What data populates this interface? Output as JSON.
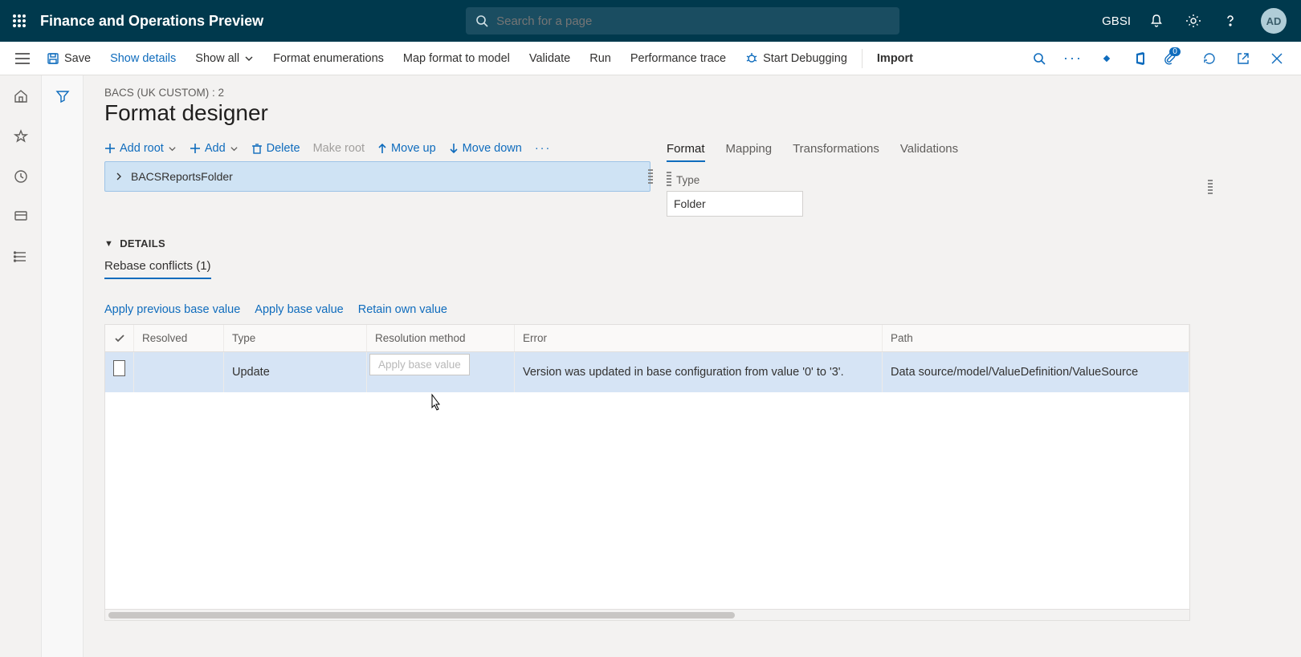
{
  "header": {
    "app_title": "Finance and Operations Preview",
    "search_placeholder": "Search for a page",
    "entity": "GBSI",
    "avatar_initials": "AD"
  },
  "action_bar": {
    "save": "Save",
    "show_details": "Show details",
    "show_all": "Show all",
    "format_enum": "Format enumerations",
    "map_format": "Map format to model",
    "validate": "Validate",
    "run": "Run",
    "perf_trace": "Performance trace",
    "start_debug": "Start Debugging",
    "import": "Import",
    "notif_count": "0"
  },
  "page": {
    "breadcrumb": "BACS (UK CUSTOM) : 2",
    "title": "Format designer"
  },
  "tree_toolbar": {
    "add_root": "Add root",
    "add": "Add",
    "delete": "Delete",
    "make_root": "Make root",
    "move_up": "Move up",
    "move_down": "Move down"
  },
  "tree": {
    "root_label": "BACSReportsFolder"
  },
  "right_tabs": {
    "format": "Format",
    "mapping": "Mapping",
    "transformations": "Transformations",
    "validations": "Validations"
  },
  "properties": {
    "type_label": "Type",
    "type_value": "Folder"
  },
  "details": {
    "section_title": "DETAILS",
    "tab_label": "Rebase conflicts (1)",
    "tooltip_text": "Apply base value",
    "actions": {
      "apply_prev": "Apply previous base value",
      "apply_base": "Apply base value",
      "retain_own": "Retain own value"
    },
    "columns": {
      "resolved": "Resolved",
      "type": "Type",
      "method": "Resolution method",
      "error": "Error",
      "path": "Path"
    },
    "rows": [
      {
        "resolved": false,
        "type": "Update",
        "method": "",
        "error": "Version was updated in base configuration from value '0' to '3'.",
        "path": "Data source/model/ValueDefinition/ValueSource"
      }
    ]
  }
}
